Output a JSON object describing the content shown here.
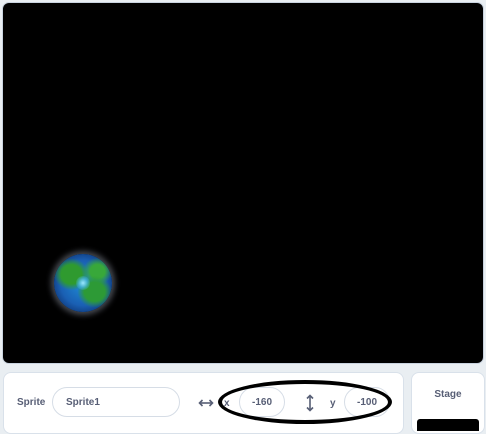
{
  "sprite_info": {
    "sprite_label": "Sprite",
    "sprite_name": "Sprite1",
    "x_label": "x",
    "x_value": "-160",
    "y_label": "y",
    "y_value": "-100"
  },
  "stage_panel": {
    "title": "Stage"
  },
  "icons": {
    "horizontal_arrows": "left-right-arrow-icon",
    "vertical_arrows": "up-down-arrow-icon"
  },
  "colors": {
    "stage_background": "#000000",
    "panel_background": "#ffffff",
    "text": "#575e75",
    "highlight": "#000000"
  }
}
